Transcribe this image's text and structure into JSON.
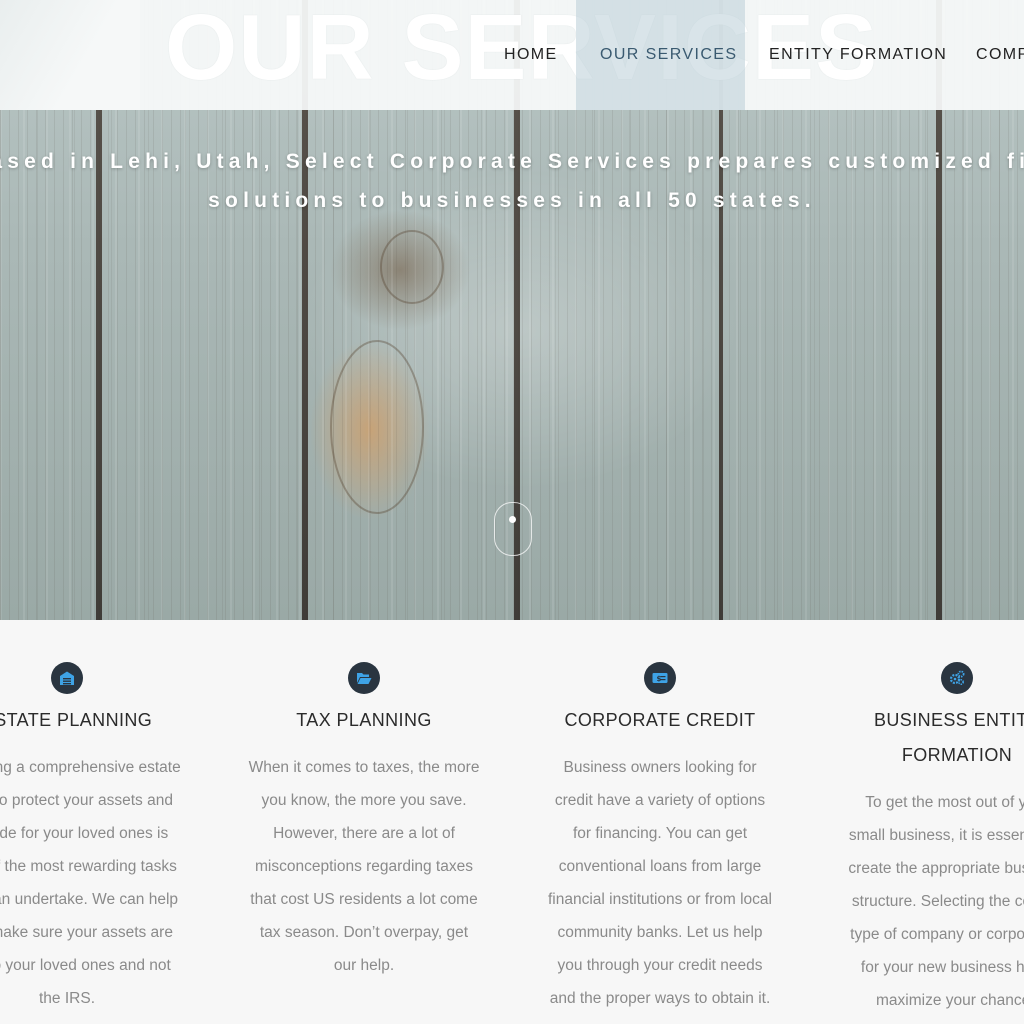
{
  "header": {
    "big_title": "OUR SERVICES",
    "nav": [
      {
        "label": "HOME"
      },
      {
        "label": "OUR SERVICES",
        "active": true
      },
      {
        "label": "ENTITY FORMATION"
      },
      {
        "label": "COMPA"
      }
    ]
  },
  "hero": {
    "tagline_line1": "Based in Lehi, Utah, Select Corporate Services prepares customized financial",
    "tagline_line2": "solutions to businesses in all 50 states."
  },
  "services": [
    {
      "icon": "garage-icon",
      "title_lines": [
        "ESTATE PLANNING"
      ],
      "body_lines": [
        "Creating a comprehensive estate",
        "plan to protect your assets and",
        "provide for your loved ones is",
        "one of the most rewarding tasks",
        "you can undertake. We can help",
        "you make sure your assets are",
        "left to your loved ones and not",
        "the IRS."
      ]
    },
    {
      "icon": "folder-open-icon",
      "title_lines": [
        "TAX PLANNING"
      ],
      "body_lines": [
        "When it comes to taxes, the more",
        "you know, the more you save.",
        "However, there are a lot of",
        "misconceptions regarding taxes",
        "that cost US residents a lot come",
        "tax season. Don’t overpay, get",
        "our help."
      ]
    },
    {
      "icon": "money-check-icon",
      "title_lines": [
        "CORPORATE CREDIT"
      ],
      "body_lines": [
        "Business owners looking for",
        "credit have a variety of options",
        "for financing. You can get",
        "conventional loans from large",
        "financial institutions or from local",
        "community banks. Let us help",
        "you through your credit needs",
        "and the proper ways to obtain it."
      ]
    },
    {
      "icon": "cogs-icon",
      "title_lines": [
        "BUSINESS ENTITY",
        "FORMATION"
      ],
      "body_lines": [
        "To get the most out of your",
        "small business, it is essential to",
        "create the appropriate business",
        "structure. Selecting the correct",
        "type of company or corporation",
        "for your new business helps",
        "maximize your chances"
      ]
    }
  ],
  "colors": {
    "icon_bg": "#2a3540",
    "icon_fg": "#3ea3e6",
    "title": "#2b2b2b",
    "body": "#8a8a8a",
    "nav_active": "#3a5a70"
  }
}
